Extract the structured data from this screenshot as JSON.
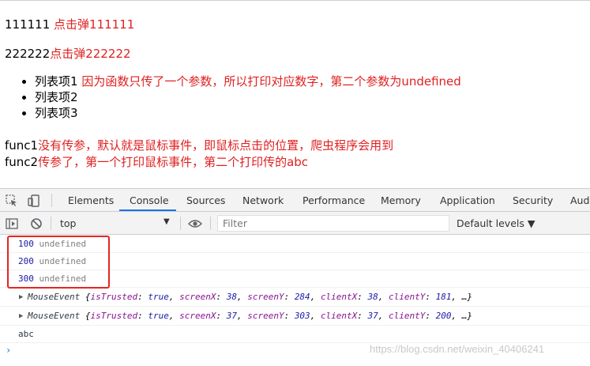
{
  "page": {
    "line1": {
      "prefix": "111111 ",
      "link": "点击弹111111"
    },
    "line2": {
      "prefix": "222222",
      "link": "点击弹222222"
    },
    "list": [
      {
        "label": "列表项1",
        "note": "因为函数只传了一个参数，所以打印对应数字，第二个参数为undefined"
      },
      {
        "label": "列表项2",
        "note": ""
      },
      {
        "label": "列表项3",
        "note": ""
      }
    ],
    "func1": {
      "name": "func1",
      "note": "没有传参，默认就是鼠标事件，即鼠标点击的位置，爬虫程序会用到"
    },
    "func2": {
      "name": "func2",
      "note": "传参了，第一个打印鼠标事件，第二个打印传的abc"
    }
  },
  "devtools": {
    "tabs": [
      "Elements",
      "Console",
      "Sources",
      "Network",
      "Performance",
      "Memory",
      "Application",
      "Security",
      "Aud"
    ],
    "active_tab": "Console",
    "icons": [
      "inspect-icon",
      "device-toggle-icon",
      "sidebar-toggle-icon",
      "clear-console-icon",
      "eye-icon"
    ],
    "context": "top",
    "filter_placeholder": "Filter",
    "levels": "Default levels ▼"
  },
  "console": {
    "logs": [
      {
        "num": "100",
        "rest": "undefined"
      },
      {
        "num": "200",
        "rest": "undefined"
      },
      {
        "num": "300",
        "rest": "undefined"
      }
    ],
    "events": [
      {
        "type": "MouseEvent",
        "isTrusted": "true",
        "screenX": "38",
        "screenY": "284",
        "clientX": "38",
        "clientY": "181"
      },
      {
        "type": "MouseEvent",
        "isTrusted": "true",
        "screenX": "37",
        "screenY": "303",
        "clientX": "37",
        "clientY": "200"
      }
    ],
    "last": "abc",
    "prompt": "›"
  },
  "watermark": "https://blog.csdn.net/weixin_40406241",
  "colors": {
    "annotation": "#e02020",
    "highlight": "#e52521",
    "active_tab": "#1a73e8"
  }
}
